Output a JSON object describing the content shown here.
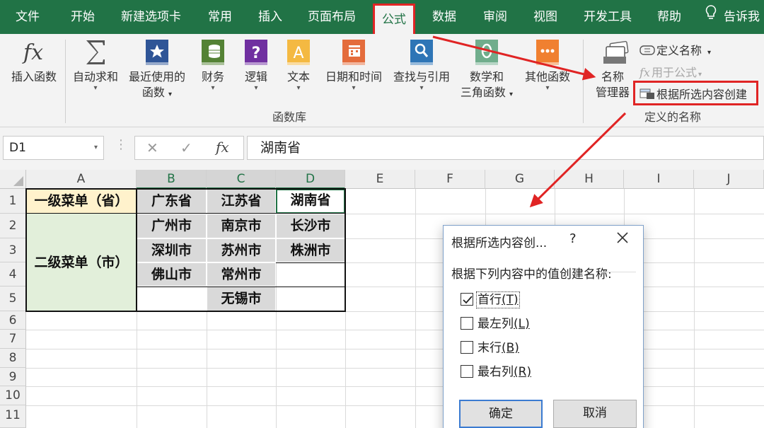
{
  "tabs": [
    {
      "label": "文件"
    },
    {
      "label": "开始"
    },
    {
      "label": "新建选项卡"
    },
    {
      "label": "常用"
    },
    {
      "label": "插入"
    },
    {
      "label": "页面布局"
    },
    {
      "label": "公式"
    },
    {
      "label": "数据"
    },
    {
      "label": "审阅"
    },
    {
      "label": "视图"
    },
    {
      "label": "开发工具"
    },
    {
      "label": "帮助"
    }
  ],
  "tell_me": "告诉我",
  "ribbon": {
    "insert_function": "插入函数",
    "autosum": "自动求和",
    "recent": [
      "最近使用的",
      "函数"
    ],
    "financial": "财务",
    "logical": "逻辑",
    "text": "文本",
    "datetime": "日期和时间",
    "lookup": "查找与引用",
    "math": [
      "数学和",
      "三角函数"
    ],
    "more": "其他函数",
    "library_label": "函数库",
    "name_manager": [
      "名称",
      "管理器"
    ],
    "define_name": "定义名称",
    "use_in_formula": "用于公式",
    "create_from_selection": "根据所选内容创建",
    "defined_names_label": "定义的名称"
  },
  "formula_bar": {
    "name_box": "D1",
    "content": "湖南省"
  },
  "columns": [
    "A",
    "B",
    "C",
    "D",
    "E",
    "F",
    "G",
    "H",
    "I",
    "J"
  ],
  "rows": [
    "1",
    "2",
    "3",
    "4",
    "5",
    "6",
    "7",
    "8",
    "9",
    "10",
    "11"
  ],
  "cells": {
    "A1": "一级菜单（省）",
    "A2": "二级菜单（市）",
    "B1": "广东省",
    "C1": "江苏省",
    "D1": "湖南省",
    "B2": "广州市",
    "C2": "南京市",
    "D2": "长沙市",
    "B3": "深圳市",
    "C3": "苏州市",
    "D3": "株洲市",
    "B4": "佛山市",
    "C4": "常州市",
    "C5": "无锡市"
  },
  "dialog": {
    "title": "根据所选内容创...",
    "help": "?",
    "prompt": "根据下列内容中的值创建名称:",
    "options": [
      {
        "text": "首行",
        "key": "(T)",
        "checked": true
      },
      {
        "text": "最左列",
        "key": "(L)",
        "checked": false
      },
      {
        "text": "末行",
        "key": "(B)",
        "checked": false
      },
      {
        "text": "最右列",
        "key": "(R)",
        "checked": false
      }
    ],
    "ok": "确定",
    "cancel": "取消"
  },
  "colors": {
    "excel_green": "#217346",
    "highlight_red": "#e02424",
    "header_yellow": "#fff2cc",
    "label_green": "#e2efda",
    "data_gray": "#d9d9d9"
  },
  "icons": [
    "fx-icon",
    "sigma-icon",
    "star-book-icon",
    "coins-book-icon",
    "question-book-icon",
    "a-book-icon",
    "calendar-book-icon",
    "magnifier-book-icon",
    "theta-book-icon",
    "dots-book-icon",
    "name-manager-icon",
    "define-name-icon",
    "fx-small-icon",
    "create-from-selection-icon",
    "lightbulb-icon"
  ]
}
